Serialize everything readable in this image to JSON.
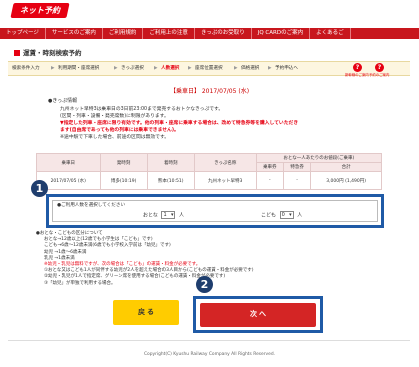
{
  "header": {
    "logo_text": "ネット予約"
  },
  "nav": {
    "items": [
      "トップページ",
      "サービスのご案内",
      "ご利用規約",
      "ご利用上の注意",
      "きっぷのお受取り",
      "JQ CARDのご案内",
      "よくあるご"
    ]
  },
  "page": {
    "title": "運賃・時刻検索予約"
  },
  "steps": {
    "items": [
      "検索条件入力",
      "利用期間・座席選択",
      "きっぷ選択",
      "人数選択",
      "座席位置選択",
      "価格選択",
      "予約申込へ"
    ],
    "active_index": 3,
    "help1": "新幹線のご案内",
    "help2": "予約のご案内"
  },
  "train": {
    "heading": "【乗車日】 2017/07/05 (水)",
    "info_label": "●きっぷ情報",
    "info_lines": [
      "九州ネット早特3は乗車日の3日前23:00まで発売するおトクなきっぷです。",
      "(区間・列車・設備・発売席数)に制限があります。"
    ],
    "warning_lines": [
      "▼指定した列車・座席に限り有効です。他の列車・座席に乗車する場合は、改めて特急券等を購入していただき",
      "ます(自由席であっても他の列車には乗車できません)。"
    ],
    "info_tail": "※途中駅で下車した場合、前途の区間は無効です。"
  },
  "fare_table": {
    "headers": [
      "乗車日",
      "発時刻",
      "着時刻",
      "きっぷ名称",
      "乗車券",
      "特急券",
      "合計"
    ],
    "group_header": "おとな一人あたりのお値段(ご乗車)",
    "row": [
      "2017/07/05 (水)",
      "博多(10:19)",
      "熊本(10:51)",
      "九州ネット早特3",
      "-",
      "-",
      "3,000円 (1,490円)"
    ]
  },
  "passengers": {
    "note": "●ご利用人数を選択してください",
    "adult_label": "おとな",
    "adult_value": "1",
    "adult_unit": "人",
    "child_label": "こども",
    "child_value": "0",
    "child_unit": "人"
  },
  "notes": {
    "lines": [
      "●おとな・こどもの区分について",
      "おとな→12歳以上(12歳でも小学生は「こども」です)",
      "こども→6歳〜12歳未満(6歳でも小学校入学前は「幼児」です)",
      "幼児 →1歳〜6歳未満",
      "乳児 →1歳未満",
      "※幼児・乳児は無料ですが、次の場合は「こども」の運賃・料金が必要です。",
      "①おとな又はこども1人が同伴する幼児が2人を超えた場合の3人目から(こどもの運賃・料金が必要です)",
      "②幼児・乳児が1人で指定席、グリーン席を使用する場合(こどもの運賃・料金が必要です)",
      "③「幼児」が単独で利用する場合。"
    ]
  },
  "buttons": {
    "back": "戻 る",
    "next": "次 へ"
  },
  "callouts": {
    "one": "1",
    "two": "2"
  },
  "footer": {
    "copyright": "Copyright(C) Kyushu Railway Company All Rights Reserved."
  },
  "colors": {
    "brand_red": "#c8161d",
    "callout_blue": "#1f5aa6",
    "back_yellow": "#ffcc00"
  }
}
